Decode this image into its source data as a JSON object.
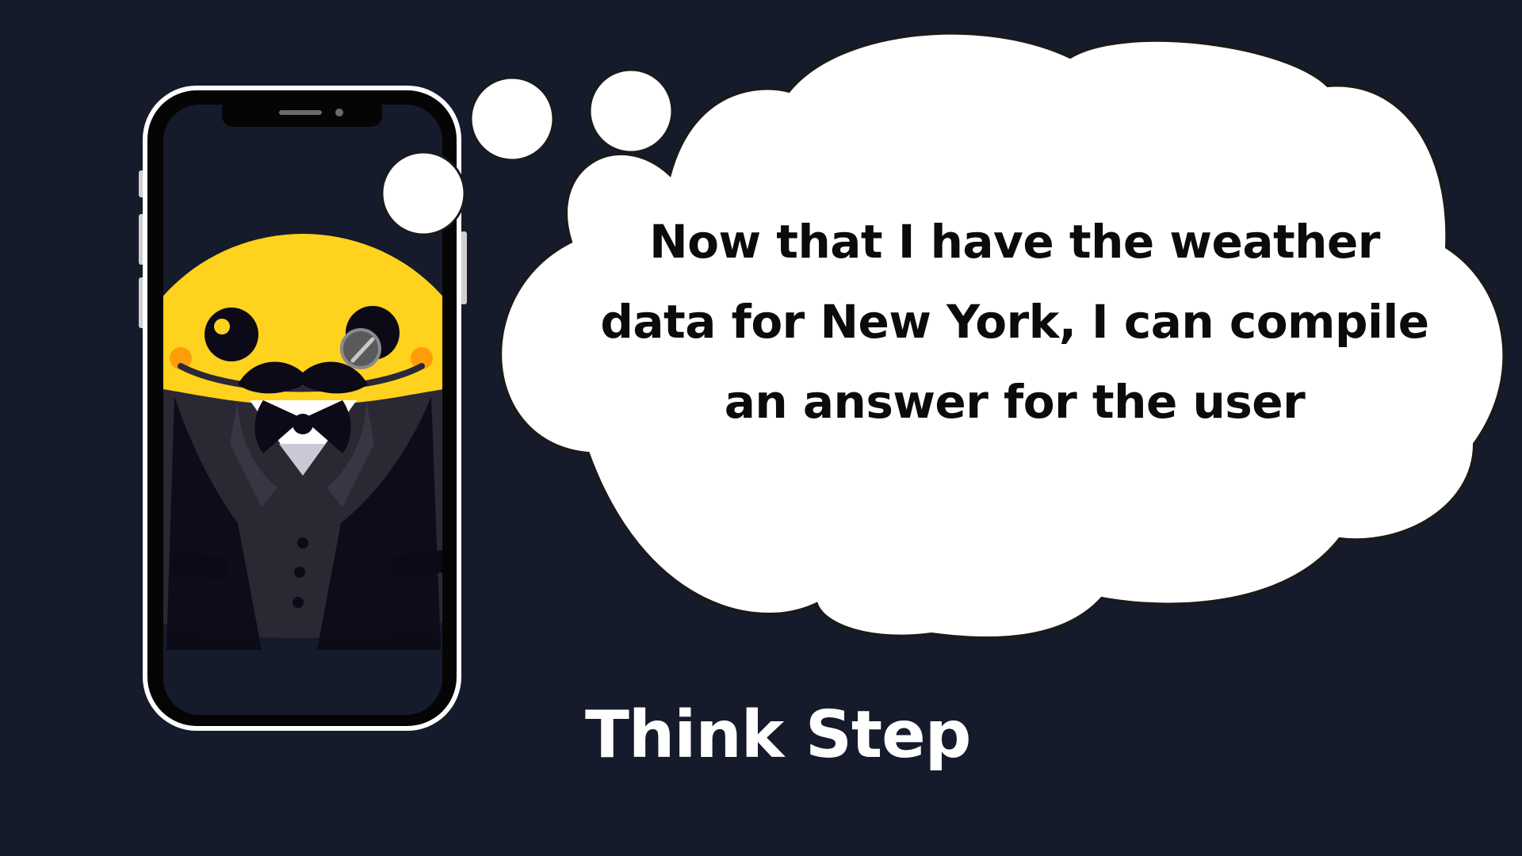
{
  "thought": {
    "lines": [
      "Now that I have the weather",
      "data for New York, I can compile",
      "an answer for the user"
    ]
  },
  "caption": "Think Step",
  "colors": {
    "background": "#151b2b",
    "cloud_fill": "#ffffff",
    "cloud_outline": "#1a1a1a",
    "phone_frame": "#050505",
    "phone_bezel": "#ffffff",
    "mascot_face": "#ffd21e",
    "mascot_shadow": "#ff9d0b",
    "suit": "#2b2733",
    "text_dark": "#0b0b0b",
    "text_light": "#ffffff"
  },
  "icons": {
    "mascot": "hugging-face-butler-icon",
    "phone": "smartphone-icon"
  }
}
